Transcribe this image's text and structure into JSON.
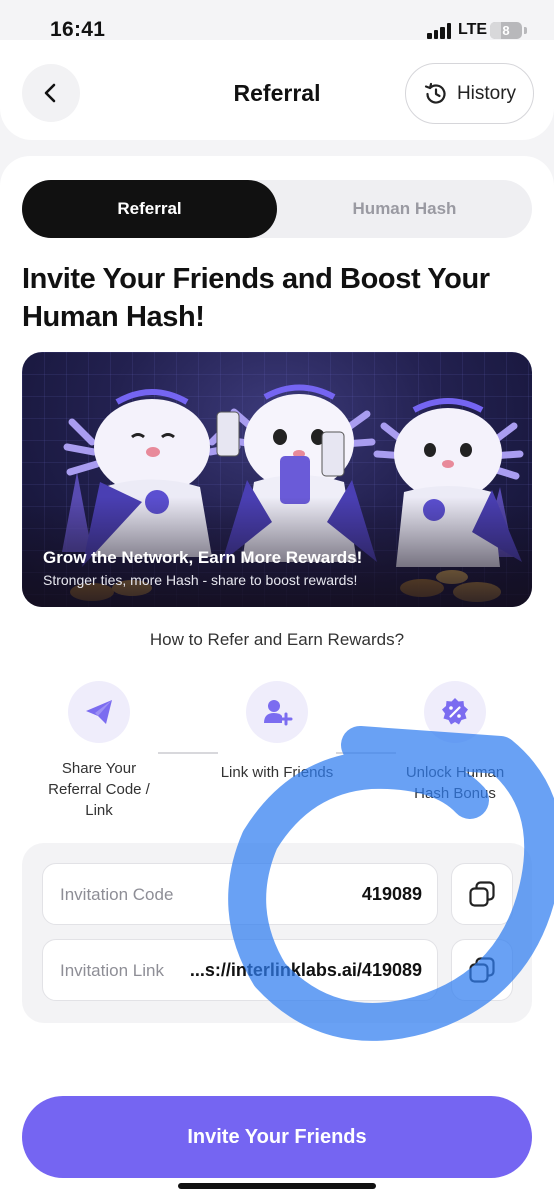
{
  "status_bar": {
    "time": "16:41",
    "network": "LTE",
    "battery": "8"
  },
  "header": {
    "title": "Referral",
    "history_label": "History"
  },
  "tabs": [
    {
      "label": "Referral",
      "active": true
    },
    {
      "label": "Human Hash",
      "active": false
    }
  ],
  "headline": "Invite Your Friends and Boost Your Human Hash!",
  "banner": {
    "title": "Grow the Network, Earn More Rewards!",
    "subtitle": "Stronger ties, more Hash - share to boost rewards!"
  },
  "how_to_title": "How to Refer and Earn Rewards?",
  "steps": [
    {
      "label": "Share Your Referral Code / Link",
      "icon": "paper-plane-icon"
    },
    {
      "label": "Link with Friends",
      "icon": "add-user-icon"
    },
    {
      "label": "Unlock Human Hash Bonus",
      "icon": "discount-badge-icon"
    }
  ],
  "invitation": {
    "code_label": "Invitation Code",
    "code_value": "419089",
    "link_label": "Invitation Link",
    "link_value": "...s://interlinklabs.ai/419089"
  },
  "cta_label": "Invite Your Friends",
  "colors": {
    "accent": "#7565f2",
    "icon_purple": "#7b6cf0",
    "tab_active_bg": "#111111",
    "scribble_blue": "#2f7df0"
  }
}
